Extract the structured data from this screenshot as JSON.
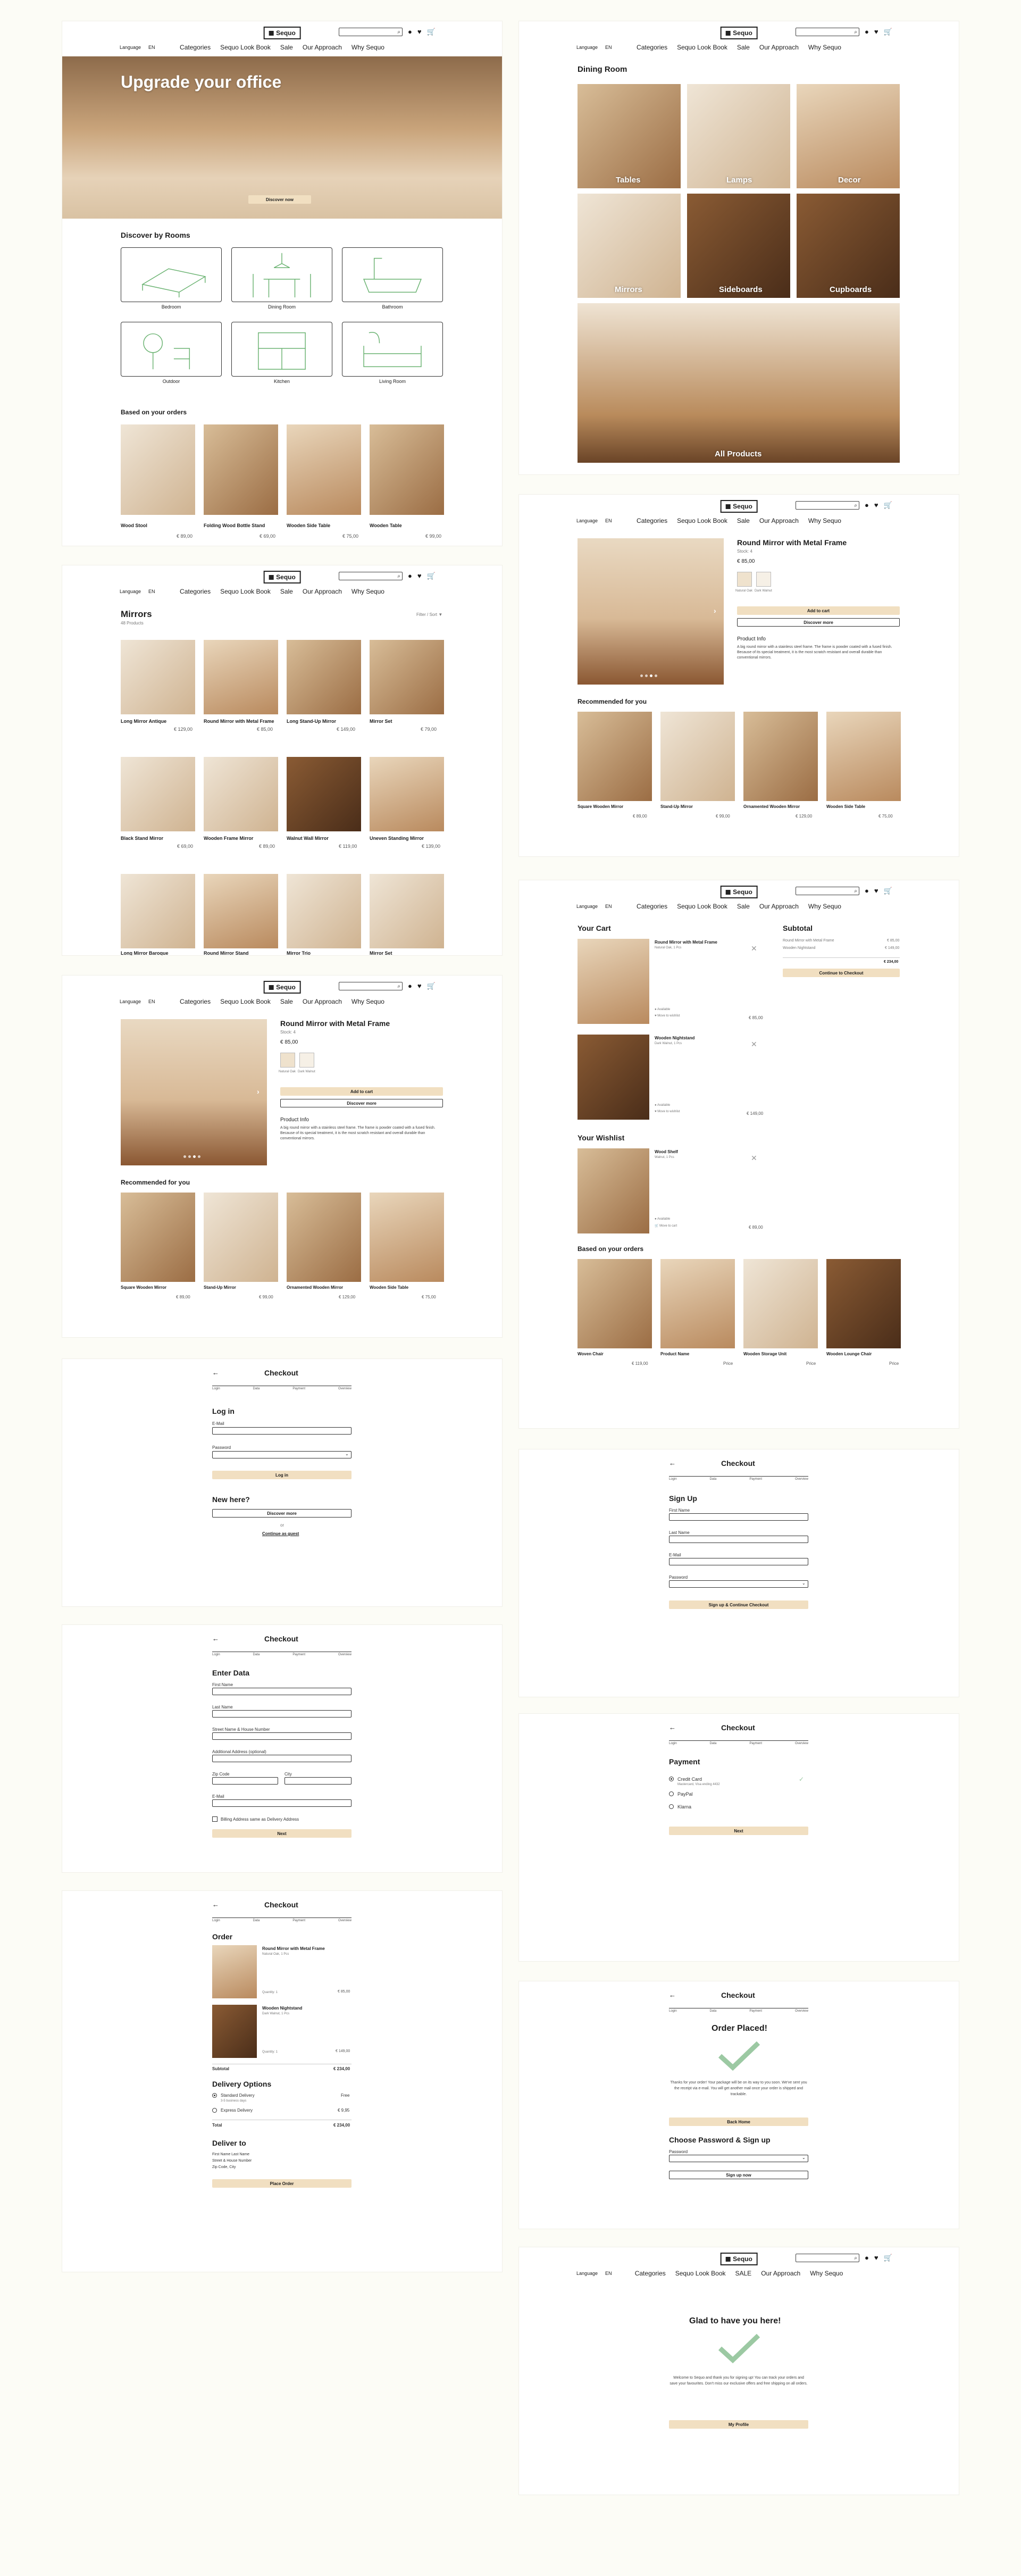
{
  "header": {
    "logo": "Sequo",
    "nav": [
      "Categories",
      "Sequo Look Book",
      "Sale",
      "Our Approach",
      "Why Sequo"
    ],
    "nav_sale_caps": "SALE",
    "language_label": "Language",
    "language_value": "EN",
    "icons": [
      "search-icon",
      "user-icon",
      "heart-icon",
      "cart-icon"
    ]
  },
  "home": {
    "hero_title": "Upgrade your office",
    "hero_button": "Discover now",
    "rooms_heading": "Discover by Rooms",
    "rooms": [
      "Bedroom",
      "Dining Room",
      "Bathroom",
      "Outdoor",
      "Kitchen",
      "Living Room"
    ],
    "orders_heading": "Based on your orders",
    "products": [
      {
        "name": "Wood Stool",
        "price": "€ 89,00"
      },
      {
        "name": "Folding Wood Bottle Stand",
        "price": "€ 69,00"
      },
      {
        "name": "Wooden Side Table",
        "price": "€ 75,00"
      },
      {
        "name": "Wooden Table",
        "price": "€ 99,00"
      }
    ]
  },
  "dining": {
    "title": "Dining Room",
    "tiles": [
      "Tables",
      "Lamps",
      "Decor",
      "Mirrors",
      "Sideboards",
      "Cupboards",
      "All Products"
    ]
  },
  "mirrors": {
    "title": "Mirrors",
    "subtitle": "48 Products",
    "filter_label": "Filter / Sort",
    "items": [
      {
        "name": "Long Mirror Antique",
        "price": "€ 129,00"
      },
      {
        "name": "Round Mirror with Metal Frame",
        "price": "€ 85,00"
      },
      {
        "name": "Long Stand-Up Mirror",
        "price": "€ 149,00"
      },
      {
        "name": "Mirror Set",
        "price": "€ 79,00"
      },
      {
        "name": "Black Stand Mirror",
        "price": "€ 69,00"
      },
      {
        "name": "Wooden Frame Mirror",
        "price": "€ 89,00"
      },
      {
        "name": "Walnut Wall Mirror",
        "price": "€ 119,00"
      },
      {
        "name": "Uneven Standing Mirror",
        "price": "€ 139,00"
      },
      {
        "name": "Long Mirror Baroque",
        "price": ""
      },
      {
        "name": "Round Mirror Stand",
        "price": ""
      },
      {
        "name": "Mirror Trio",
        "price": ""
      },
      {
        "name": "Mirror Set",
        "price": ""
      }
    ]
  },
  "product": {
    "title": "Round Mirror with Metal Frame",
    "sub": "Stock: 4",
    "price": "€ 85,00",
    "variants": [
      "Natural Oak",
      "Dark Walnut"
    ],
    "add_to_cart": "Add to cart",
    "discover": "Discover more",
    "info_heading": "Product Info",
    "info": "A big round mirror with a stainless steel frame. The frame is powder coated with a fused finish. Because of its special treatment, it is the most scratch resistant and overall durable than conventional mirrors.",
    "recommended_heading": "Recommended for you",
    "recommended": [
      {
        "name": "Square Wooden Mirror",
        "price": "€ 89,00"
      },
      {
        "name": "Stand-Up Mirror",
        "price": "€ 99,00"
      },
      {
        "name": "Ornamented Wooden Mirror",
        "price": "€ 129,00"
      },
      {
        "name": "Wooden Side Table",
        "price": "€ 75,00"
      }
    ]
  },
  "cart": {
    "title": "Your Cart",
    "items": [
      {
        "name": "Round Mirror with Metal Frame",
        "meta": "Natural Oak, 1 Pcs",
        "avail": "Available",
        "wish": "Move to wishlist",
        "price": "€ 85,00"
      },
      {
        "name": "Wooden Nightstand",
        "meta": "Dark Walnut, 1 Pcs",
        "avail": "Available",
        "wish": "Move to wishlist",
        "price": "€ 149,00"
      }
    ],
    "subtotal_heading": "Subtotal",
    "subtotal_lines": [
      {
        "label": "Round Mirror with Metal Frame",
        "value": "€ 85,00"
      },
      {
        "label": "Wooden Nightstand",
        "value": "€ 149,00"
      }
    ],
    "subtotal_total": "€ 234,00",
    "checkout_button": "Continue to Checkout",
    "wishlist_heading": "Your Wishlist",
    "wishlist_items": [
      {
        "name": "Wood Shelf",
        "meta": "Walnut, 1 Pcs",
        "avail": "Available",
        "cta": "Move to cart",
        "price": "€ 89,00"
      }
    ],
    "orders_heading": "Based on your orders",
    "orders": [
      {
        "name": "Woven Chair",
        "price": "€ 119,00"
      },
      {
        "name": "Product Name",
        "price": "Price"
      },
      {
        "name": "Wooden Storage Unit",
        "price": "Price"
      },
      {
        "name": "Wooden Lounge Chair",
        "price": "Price"
      }
    ]
  },
  "checkout": {
    "title": "Checkout",
    "steps": [
      "Login",
      "Data",
      "Payment",
      "Overview"
    ],
    "login": {
      "heading": "Log in",
      "email": "E-Mail",
      "password": "Password",
      "button": "Log in",
      "new_heading": "New here?",
      "new_button": "Discover more",
      "or": "or",
      "guest": "Continue as guest"
    },
    "signup": {
      "heading": "Sign Up",
      "fields": [
        "First Name",
        "Last Name",
        "E-Mail",
        "Password"
      ],
      "button": "Sign up & Continue Checkout"
    },
    "data": {
      "heading": "Enter Data",
      "fields": [
        "First Name",
        "Last Name",
        "Street Name & House Number",
        "Additional Address (optional)",
        "Zip Code",
        "City",
        "E-Mail"
      ],
      "billing": "Billing Address same as Delivery Address",
      "button": "Next"
    },
    "payment": {
      "heading": "Payment",
      "options": [
        "Credit Card",
        "PayPal",
        "Klarna"
      ],
      "card_note": "Mastercard, Visa ending 4432",
      "button": "Next"
    },
    "order": {
      "heading": "Order",
      "items": [
        {
          "name": "Round Mirror with Metal Frame",
          "meta": "Natural Oak, 1 Pcs",
          "qty": "Quantity: 1",
          "price": "€ 85,00"
        },
        {
          "name": "Wooden Nightstand",
          "meta": "Dark Walnut, 1 Pcs",
          "qty": "Quantity: 1",
          "price": "€ 149,00"
        }
      ],
      "subtotal_label": "Subtotal",
      "subtotal": "€ 234,00",
      "delivery_heading": "Delivery Options",
      "delivery": [
        {
          "label": "Standard Delivery",
          "note": "3-5 business days",
          "price": "Free"
        },
        {
          "label": "Express Delivery",
          "note": "",
          "price": "€ 9,95"
        }
      ],
      "total_label": "Total",
      "total": "€ 234,00",
      "deliver_heading": "Deliver to",
      "address": [
        "First Name Last Name",
        "Street & House Number",
        "Zip Code, City"
      ],
      "button": "Place Order"
    },
    "placed": {
      "heading": "Order Placed!",
      "text": "Thanks for your order! Your package will be on its way to you soon. We've sent you the receipt via e-mail. You will get another mail once your order is shipped and trackable.",
      "button": "Back Home",
      "pw_heading": "Choose Password & Sign up",
      "pw_label": "Password",
      "pw_button": "Sign up now"
    }
  },
  "welcome": {
    "heading": "Glad to have you here!",
    "text": "Welcome to Sequo and thank you for signing up! You can track your orders and save your favourites. Don't miss our exclusive offers and free shipping on all orders.",
    "button": "My Profile"
  }
}
